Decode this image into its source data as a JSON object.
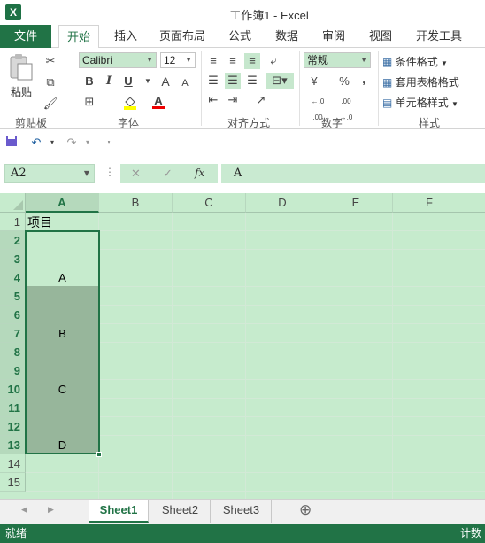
{
  "title": {
    "app_icon": "X",
    "window_title": "工作簿1 - Excel"
  },
  "tabs": [
    {
      "label": "文件"
    },
    {
      "label": "开始"
    },
    {
      "label": "插入"
    },
    {
      "label": "页面布局"
    },
    {
      "label": "公式"
    },
    {
      "label": "数据"
    },
    {
      "label": "审阅"
    },
    {
      "label": "视图"
    },
    {
      "label": "开发工具"
    }
  ],
  "ribbon": {
    "clipboard": {
      "paste_label": "粘贴",
      "group_label": "剪贴板"
    },
    "font": {
      "font_name": "Calibri",
      "font_size": "12",
      "group_label": "字体",
      "bold": "B",
      "italic": "I",
      "underline": "U",
      "grow": "A",
      "shrink": "A",
      "font_color_letter": "A"
    },
    "alignment": {
      "group_label": "对齐方式"
    },
    "number": {
      "format": "常规",
      "currency": "¥",
      "percent": "%",
      "comma": ",",
      "inc_decimal": "←.0 .00",
      "dec_decimal": ".00 →.0",
      "group_label": "数字"
    },
    "styles": {
      "cond_format": "条件格式",
      "table_format": "套用表格格式",
      "cell_styles": "单元格样式",
      "group_label": "样式"
    }
  },
  "qat": {
    "save": "save-icon",
    "undo": "undo-icon",
    "redo": "redo-icon"
  },
  "formula_bar": {
    "name_box": "A2",
    "cancel": "✕",
    "enter": "✓",
    "fx": "fx",
    "formula": "A"
  },
  "grid": {
    "columns": [
      "A",
      "B",
      "C",
      "D",
      "E",
      "F"
    ],
    "rows": [
      "1",
      "2",
      "3",
      "4",
      "5",
      "6",
      "7",
      "8",
      "9",
      "10",
      "11",
      "12",
      "13",
      "14",
      "15"
    ],
    "cells": {
      "A1": "项目",
      "A4": "A",
      "A7": "B",
      "A10": "C",
      "A13": "D"
    }
  },
  "sheet_tabs": [
    "Sheet1",
    "Sheet2",
    "Sheet3"
  ],
  "add_sheet": "⊕",
  "status": {
    "left": "就绪",
    "right": "计数"
  },
  "colors": {
    "accent": "#217346",
    "grid_bg": "#c6ebcd",
    "selection": "#97b69b"
  }
}
